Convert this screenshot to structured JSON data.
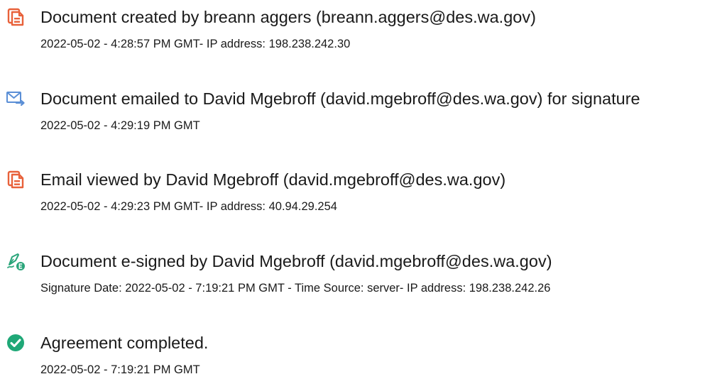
{
  "events": [
    {
      "icon": "document-created-icon",
      "title": "Document created by breann aggers (breann.aggers@des.wa.gov)",
      "detail": "2022-05-02 - 4:28:57 PM GMT- IP address: 198.238.242.30"
    },
    {
      "icon": "email-sent-icon",
      "title": "Document emailed to David Mgebroff (david.mgebroff@des.wa.gov) for signature",
      "detail": "2022-05-02 - 4:29:19 PM GMT"
    },
    {
      "icon": "email-viewed-icon",
      "title": "Email viewed by David Mgebroff (david.mgebroff@des.wa.gov)",
      "detail": "2022-05-02 - 4:29:23 PM GMT- IP address: 40.94.29.254"
    },
    {
      "icon": "e-sign-pen-icon",
      "title": "Document e-signed by David Mgebroff (david.mgebroff@des.wa.gov)",
      "detail": "Signature Date: 2022-05-02 - 7:19:21 PM GMT - Time Source: server- IP address: 198.238.242.26"
    },
    {
      "icon": "checkmark-circle-icon",
      "title": "Agreement completed.",
      "detail": "2022-05-02 - 7:19:21 PM GMT"
    }
  ],
  "colors": {
    "document_icon": "#e8613a",
    "email_icon": "#5b8fd6",
    "sign_icon": "#2aa57a",
    "complete_icon": "#1fa877",
    "text": "#1a1a1a"
  }
}
